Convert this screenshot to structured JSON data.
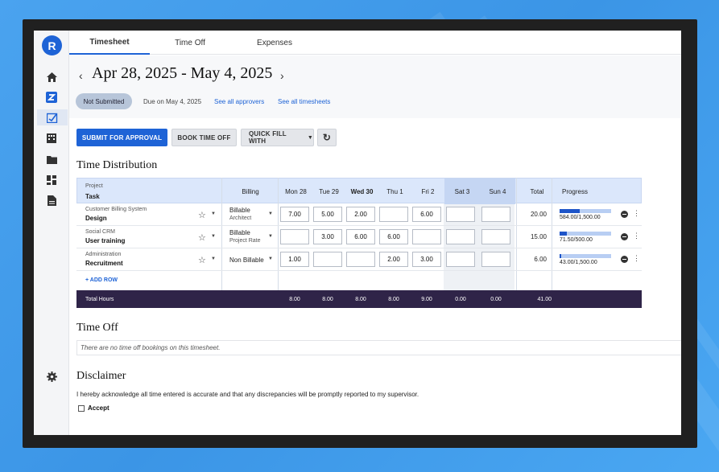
{
  "app": {
    "logo_letter": "R"
  },
  "sidebar": {
    "icons": [
      "home-icon",
      "z-app-icon",
      "timesheet-icon",
      "building-icon",
      "folder-icon",
      "dashboard-icon",
      "document-icon"
    ],
    "settings_icon": "gear-icon"
  },
  "tabs": [
    {
      "label": "Timesheet",
      "active": true
    },
    {
      "label": "Time Off",
      "active": false
    },
    {
      "label": "Expenses",
      "active": false
    }
  ],
  "header": {
    "date_range": "Apr 28, 2025 - May 4, 2025",
    "status": "Not Submitted",
    "due": "Due on May 4, 2025",
    "approvers_link": "See all approvers",
    "timesheets_link": "See all timesheets"
  },
  "actions": {
    "submit": "SUBMIT FOR APPROVAL",
    "book_time_off": "BOOK TIME OFF",
    "quick_fill": "QUICK FILL WITH"
  },
  "time_distribution": {
    "title": "Time Distribution",
    "headers": {
      "project": "Project",
      "task": "Task",
      "billing": "Billing",
      "total": "Total",
      "progress": "Progress"
    },
    "days": [
      "Mon 28",
      "Tue 29",
      "Wed 30",
      "Thu 1",
      "Fri 2",
      "Sat 3",
      "Sun 4"
    ],
    "rows": [
      {
        "project": "Customer Billing System",
        "task": "Design",
        "billing": "Billable",
        "billing_sub": "Architect",
        "hours": [
          "7.00",
          "5.00",
          "2.00",
          "",
          "6.00",
          "",
          ""
        ],
        "total": "20.00",
        "progress_text": "584.00/1,500.00",
        "progress_fraction": 0.389
      },
      {
        "project": "Social CRM",
        "task": "User training",
        "billing": "Billable",
        "billing_sub": "Project Rate",
        "hours": [
          "",
          "3.00",
          "6.00",
          "6.00",
          "",
          "",
          ""
        ],
        "total": "15.00",
        "progress_text": "71.50/500.00",
        "progress_fraction": 0.143
      },
      {
        "project": "Administration",
        "task": "Recruitment",
        "billing": "Non Billable",
        "billing_sub": "",
        "hours": [
          "1.00",
          "",
          "",
          "2.00",
          "3.00",
          "",
          ""
        ],
        "total": "6.00",
        "progress_text": "43.00/1,500.00",
        "progress_fraction": 0.029
      }
    ],
    "add_row": "+ ADD ROW",
    "total_label": "Total Hours",
    "day_totals": [
      "8.00",
      "8.00",
      "8.00",
      "8.00",
      "9.00",
      "0.00",
      "0.00"
    ],
    "grand_total": "41.00"
  },
  "time_off": {
    "title": "Time Off",
    "empty": "There are no time off bookings on this timesheet."
  },
  "disclaimer": {
    "title": "Disclaimer",
    "text": "I hereby acknowledge all time entered is accurate and that any discrepancies will be promptly reported to my supervisor.",
    "accept": "Accept"
  },
  "colors": {
    "primary": "#1e63d6",
    "total_row": "#2f2448",
    "header_row": "#dbe7fb"
  }
}
